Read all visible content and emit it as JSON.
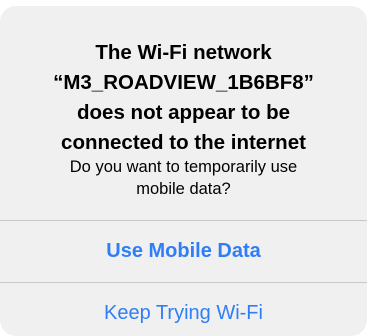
{
  "alert": {
    "title_lines": [
      "The Wi-Fi network",
      "“M3_ROADVIEW_1B6BF8”",
      "does not appear to be",
      "connected to the internet"
    ],
    "message_lines": [
      "Do you want to temporarily use",
      "mobile data?"
    ],
    "actions": {
      "use_mobile_data": "Use Mobile Data",
      "keep_trying_wifi": "Keep Trying Wi-Fi"
    },
    "colors": {
      "background": "#f0f0f0",
      "action": "#2f7ef6",
      "divider": "#c8c8cc"
    }
  }
}
